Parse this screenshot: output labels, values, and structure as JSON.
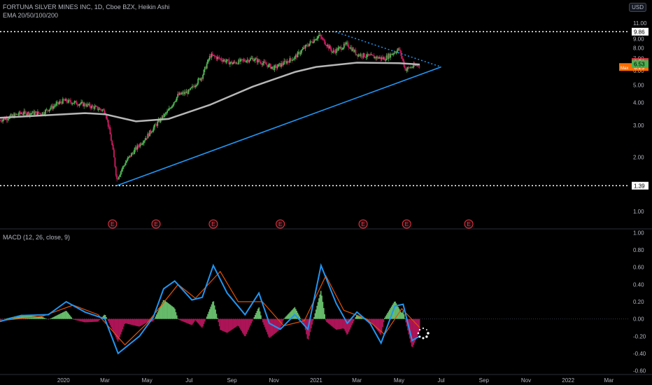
{
  "header": {
    "symbol_line": "FORTUNA SILVER MINES INC, 1D, Cboe BZX, Heikin Ashi",
    "ema_line": "EMA 20/50/100/200",
    "currency_button": "USD"
  },
  "colors": {
    "background": "#000000",
    "up_candle": "#26a69a",
    "up_candle_body": "#4caf50",
    "down_candle": "#c2185b",
    "ema": "#b7b7b7",
    "trendline": "#2196f3",
    "macd_line": "#2196f3",
    "signal_line": "#e65100",
    "hist_up": "#66bb6a",
    "hist_down": "#ad1457",
    "dotted_level": "#ffffff",
    "earnings": "#f23645"
  },
  "chart_data": [
    {
      "type": "candlestick",
      "scale": "log",
      "x_ticks": [
        "2020",
        "Mar",
        "May",
        "Jul",
        "Sep",
        "Nov",
        "2021",
        "Mar",
        "May",
        "Jul",
        "Sep",
        "Nov",
        "2022",
        "Mar"
      ],
      "x_range": [
        "2019-10-01",
        "2022-03-31"
      ],
      "y_ticks": [
        "1.00",
        "2.00",
        "3.00",
        "4.00",
        "5.00",
        "6.00",
        "7.00",
        "8.00",
        "9.00",
        "10.00",
        "11.00"
      ],
      "ylim": [
        0.95,
        11.5
      ],
      "price_labels": [
        {
          "text": "9.86",
          "value": 9.86,
          "style": "white"
        },
        {
          "text": "1.39",
          "value": 1.39,
          "style": "white"
        },
        {
          "text": "6.70",
          "value": 6.7,
          "style": "red"
        },
        {
          "text": "6.29",
          "value": 6.29,
          "style": "orange",
          "prefix": "Max"
        },
        {
          "text": "6.53",
          "value": 6.53,
          "style": "green"
        }
      ],
      "horizontal_levels": [
        9.86,
        1.39
      ],
      "ohlc_close_path": [
        [
          "2019-10-01",
          3.2
        ],
        [
          "2019-11-01",
          3.5
        ],
        [
          "2019-12-01",
          3.5
        ],
        [
          "2020-01-01",
          4.1
        ],
        [
          "2020-02-01",
          3.9
        ],
        [
          "2020-03-01",
          3.6
        ],
        [
          "2020-03-18",
          1.5
        ],
        [
          "2020-04-01",
          1.9
        ],
        [
          "2020-05-01",
          2.6
        ],
        [
          "2020-06-01",
          3.6
        ],
        [
          "2020-06-15",
          4.4
        ],
        [
          "2020-07-01",
          4.6
        ],
        [
          "2020-07-20",
          5.6
        ],
        [
          "2020-08-01",
          7.3
        ],
        [
          "2020-09-01",
          6.6
        ],
        [
          "2020-10-01",
          7.0
        ],
        [
          "2020-11-01",
          6.2
        ],
        [
          "2020-12-01",
          7.1
        ],
        [
          "2021-01-05",
          9.4
        ],
        [
          "2021-01-25",
          7.6
        ],
        [
          "2021-02-15",
          8.4
        ],
        [
          "2021-03-01",
          7.4
        ],
        [
          "2021-03-20",
          7.2
        ],
        [
          "2021-04-10",
          7.0
        ],
        [
          "2021-05-01",
          7.9
        ],
        [
          "2021-05-10",
          6.1
        ],
        [
          "2021-05-31",
          6.53
        ]
      ],
      "ema": [
        [
          "2019-10-01",
          3.3
        ],
        [
          "2020-02-01",
          3.5
        ],
        [
          "2020-03-01",
          3.45
        ],
        [
          "2020-04-15",
          3.15
        ],
        [
          "2020-06-01",
          3.25
        ],
        [
          "2020-08-01",
          3.9
        ],
        [
          "2020-10-01",
          4.9
        ],
        [
          "2020-12-01",
          5.9
        ],
        [
          "2021-01-01",
          6.3
        ],
        [
          "2021-03-01",
          6.65
        ],
        [
          "2021-05-01",
          6.6
        ],
        [
          "2021-05-31",
          6.5
        ]
      ],
      "trendlines": [
        {
          "style": "solid",
          "from": [
            "2020-03-18",
            1.39
          ],
          "to": [
            "2021-07-01",
            6.3
          ]
        },
        {
          "style": "dotted",
          "from": [
            "2021-01-28",
            9.86
          ],
          "to": [
            "2021-07-01",
            6.3
          ]
        }
      ],
      "earnings_markers": [
        "2020-03-12",
        "2020-05-14",
        "2020-08-05",
        "2020-11-10",
        "2021-03-10",
        "2021-05-12",
        "2021-08-10"
      ],
      "earnings_label": "E"
    },
    {
      "type": "line",
      "title": "MACD (12, 26, close, 9)",
      "y_ticks": [
        "-0.60",
        "-0.40",
        "-0.20",
        "0.00",
        "0.20",
        "0.40",
        "0.60",
        "0.80",
        "1.00"
      ],
      "ylim": [
        -0.62,
        1.02
      ],
      "series": [
        {
          "role": "macd",
          "values": [
            [
              "2019-10-01",
              -0.03
            ],
            [
              "2019-11-01",
              0.04
            ],
            [
              "2019-12-10",
              0.05
            ],
            [
              "2020-01-05",
              0.2
            ],
            [
              "2020-02-01",
              0.08
            ],
            [
              "2020-03-01",
              0.0
            ],
            [
              "2020-03-20",
              -0.4
            ],
            [
              "2020-04-20",
              -0.2
            ],
            [
              "2020-05-10",
              0.02
            ],
            [
              "2020-05-25",
              0.35
            ],
            [
              "2020-06-10",
              0.44
            ],
            [
              "2020-07-05",
              0.22
            ],
            [
              "2020-07-20",
              0.25
            ],
            [
              "2020-08-05",
              0.62
            ],
            [
              "2020-08-25",
              0.3
            ],
            [
              "2020-09-20",
              0.05
            ],
            [
              "2020-10-10",
              0.3
            ],
            [
              "2020-10-25",
              -0.05
            ],
            [
              "2020-11-10",
              -0.12
            ],
            [
              "2020-12-01",
              0.05
            ],
            [
              "2020-12-20",
              -0.12
            ],
            [
              "2021-01-08",
              0.62
            ],
            [
              "2021-01-30",
              0.18
            ],
            [
              "2021-02-15",
              -0.05
            ],
            [
              "2021-03-01",
              0.08
            ],
            [
              "2021-03-20",
              -0.05
            ],
            [
              "2021-04-05",
              -0.28
            ],
            [
              "2021-04-25",
              0.15
            ],
            [
              "2021-05-07",
              0.17
            ],
            [
              "2021-05-20",
              -0.25
            ],
            [
              "2021-05-31",
              -0.2
            ]
          ]
        },
        {
          "role": "signal",
          "values": [
            [
              "2019-10-01",
              -0.02
            ],
            [
              "2019-12-01",
              0.03
            ],
            [
              "2020-01-15",
              0.16
            ],
            [
              "2020-02-20",
              0.05
            ],
            [
              "2020-03-30",
              -0.3
            ],
            [
              "2020-05-01",
              -0.05
            ],
            [
              "2020-06-15",
              0.4
            ],
            [
              "2020-07-10",
              0.24
            ],
            [
              "2020-08-15",
              0.55
            ],
            [
              "2020-09-10",
              0.2
            ],
            [
              "2020-10-15",
              0.2
            ],
            [
              "2020-11-15",
              -0.08
            ],
            [
              "2020-12-15",
              -0.02
            ],
            [
              "2021-01-15",
              0.5
            ],
            [
              "2021-02-10",
              0.1
            ],
            [
              "2021-03-15",
              0.0
            ],
            [
              "2021-04-10",
              -0.18
            ],
            [
              "2021-05-05",
              0.12
            ],
            [
              "2021-05-31",
              -0.1
            ]
          ]
        }
      ]
    }
  ]
}
